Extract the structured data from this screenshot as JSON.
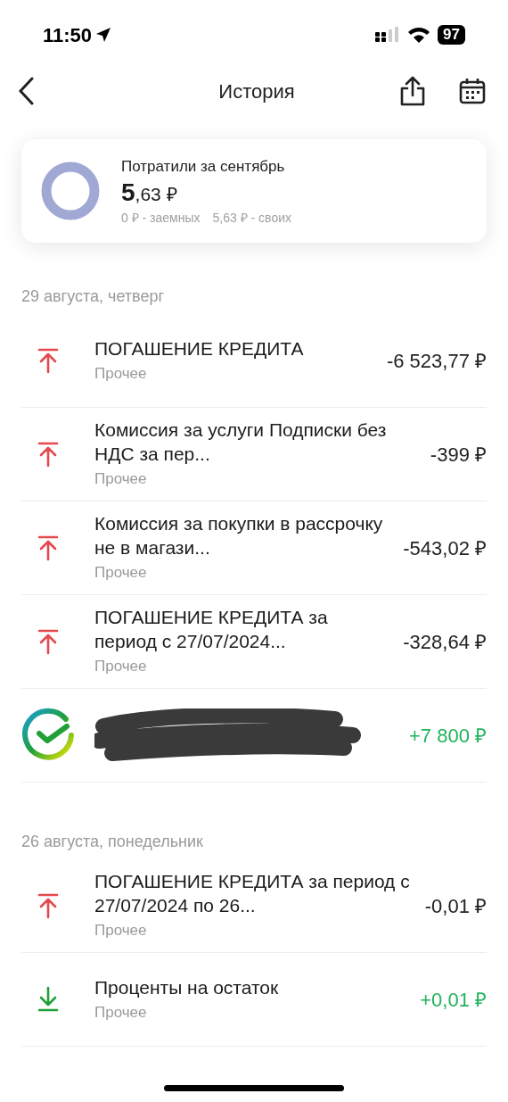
{
  "status_bar": {
    "time": "11:50",
    "battery": "97"
  },
  "nav": {
    "title": "История"
  },
  "summary": {
    "title": "Потратили за сентябрь",
    "amount_whole": "5",
    "amount_rest": ",63 ₽",
    "borrowed": "0 ₽ - заемных",
    "own": "5,63 ₽ - своих"
  },
  "groups": [
    {
      "date": "29 августа, четверг",
      "items": [
        {
          "kind": "expense",
          "title": "ПОГАШЕНИЕ КРЕДИТА",
          "category": "Прочее",
          "amount": "-6 523,77 ₽"
        },
        {
          "kind": "expense",
          "title": "Комиссия за услуги Подписки без НДС за пер...",
          "category": "Прочее",
          "amount": "-399 ₽"
        },
        {
          "kind": "expense",
          "title": "Комиссия за покупки в рассрочку не в магази...",
          "category": "Прочее",
          "amount": "-543,02 ₽"
        },
        {
          "kind": "expense",
          "title": "ПОГАШЕНИЕ КРЕДИТА за период с 27/07/2024...",
          "category": "Прочее",
          "amount": "-328,64 ₽"
        },
        {
          "kind": "transfer",
          "amount": "+7 800 ₽"
        }
      ]
    },
    {
      "date": "26 августа, понедельник",
      "items": [
        {
          "kind": "expense",
          "title": "ПОГАШЕНИЕ КРЕДИТА за период с 27/07/2024 по 26...",
          "category": "Прочее",
          "amount": "-0,01 ₽"
        },
        {
          "kind": "income",
          "title": "Проценты на остаток",
          "category": "Прочее",
          "amount": "+0,01 ₽"
        }
      ]
    }
  ]
}
